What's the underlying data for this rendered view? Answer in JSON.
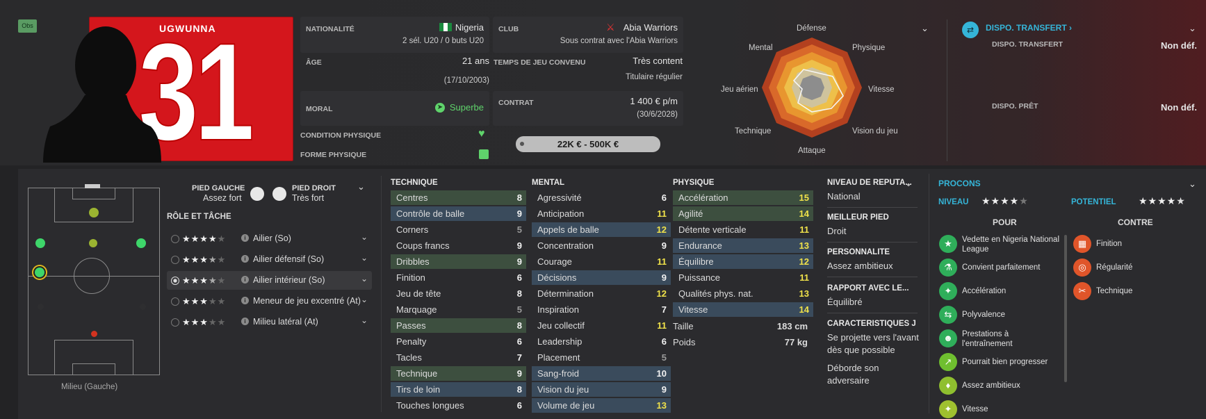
{
  "badge": "Obs",
  "player": {
    "name": "UGWUNNA",
    "number": "31"
  },
  "nationality": {
    "label": "NATIONALITÉ",
    "country": "Nigeria",
    "caps": "2 sél. U20 / 0 buts U20"
  },
  "club": {
    "label": "CLUB",
    "name": "Abia Warriors",
    "contract_note": "Sous contrat avec l'Abia Warriors"
  },
  "age": {
    "label": "ÂGE",
    "value": "21 ans",
    "dob": "(17/10/2003)"
  },
  "playing_time": {
    "label": "TEMPS DE JEU CONVENU",
    "satisfaction": "Très content",
    "status": "Titulaire régulier"
  },
  "morale": {
    "label": "MORAL",
    "value": "Superbe"
  },
  "contract": {
    "label": "CONTRAT",
    "wage": "1 400 € p/m",
    "expiry": "(30/6/2028)"
  },
  "condition": {
    "label": "CONDITION PHYSIQUE"
  },
  "form": {
    "label": "FORME PHYSIQUE"
  },
  "value_range": "22K € - 500K €",
  "radar": {
    "labels": [
      "Défense",
      "Physique",
      "Vitesse",
      "Vision du jeu",
      "Attaque",
      "Technique",
      "Jeu aérien",
      "Mental"
    ]
  },
  "transfer": {
    "header": "DISPO. TRANSFERT",
    "transfer_label": "DISPO. TRANSFERT",
    "transfer_value": "Non déf.",
    "loan_label": "DISPO. PRÊT",
    "loan_value": "Non déf."
  },
  "feet": {
    "left_label": "PIED GAUCHE",
    "left_value": "Assez fort",
    "right_label": "PIED DROIT",
    "right_value": "Très fort"
  },
  "roles_title": "RÔLE ET TÂCHE",
  "roles": [
    {
      "name": "Ailier (So)",
      "stars": 4
    },
    {
      "name": "Ailier défensif (So)",
      "stars": 3.5
    },
    {
      "name": "Ailier intérieur (So)",
      "stars": 3.5
    },
    {
      "name": "Meneur de jeu excentré (At)",
      "stars": 3
    },
    {
      "name": "Milieu latéral (At)",
      "stars": 3
    }
  ],
  "position_label": "Milieu (Gauche)",
  "technique": {
    "title": "TECHNIQUE",
    "attrs": [
      {
        "n": "Centres",
        "v": "8"
      },
      {
        "n": "Contrôle de balle",
        "v": "9"
      },
      {
        "n": "Corners",
        "v": "5"
      },
      {
        "n": "Coups francs",
        "v": "9"
      },
      {
        "n": "Dribbles",
        "v": "9"
      },
      {
        "n": "Finition",
        "v": "6"
      },
      {
        "n": "Jeu de tête",
        "v": "8"
      },
      {
        "n": "Marquage",
        "v": "5"
      },
      {
        "n": "Passes",
        "v": "8"
      },
      {
        "n": "Penalty",
        "v": "6"
      },
      {
        "n": "Tacles",
        "v": "7"
      },
      {
        "n": "Technique",
        "v": "9"
      },
      {
        "n": "Tirs de loin",
        "v": "8"
      },
      {
        "n": "Touches longues",
        "v": "6"
      }
    ]
  },
  "mental": {
    "title": "MENTAL",
    "attrs": [
      {
        "n": "Agressivité",
        "v": "6"
      },
      {
        "n": "Anticipation",
        "v": "11"
      },
      {
        "n": "Appels de balle",
        "v": "12"
      },
      {
        "n": "Concentration",
        "v": "9"
      },
      {
        "n": "Courage",
        "v": "11"
      },
      {
        "n": "Décisions",
        "v": "9"
      },
      {
        "n": "Détermination",
        "v": "12"
      },
      {
        "n": "Inspiration",
        "v": "7"
      },
      {
        "n": "Jeu collectif",
        "v": "11"
      },
      {
        "n": "Leadership",
        "v": "6"
      },
      {
        "n": "Placement",
        "v": "5"
      },
      {
        "n": "Sang-froid",
        "v": "10"
      },
      {
        "n": "Vision du jeu",
        "v": "9"
      },
      {
        "n": "Volume de jeu",
        "v": "13"
      }
    ]
  },
  "physique": {
    "title": "PHYSIQUE",
    "attrs": [
      {
        "n": "Accélération",
        "v": "15"
      },
      {
        "n": "Agilité",
        "v": "14"
      },
      {
        "n": "Détente verticale",
        "v": "11"
      },
      {
        "n": "Endurance",
        "v": "13"
      },
      {
        "n": "Équilibre",
        "v": "12"
      },
      {
        "n": "Puissance",
        "v": "11"
      },
      {
        "n": "Qualités phys. nat.",
        "v": "13"
      },
      {
        "n": "Vitesse",
        "v": "14"
      }
    ],
    "height_label": "Taille",
    "height": "183 cm",
    "weight_label": "Poids",
    "weight": "77 kg"
  },
  "info": {
    "rep_label": "NIVEAU DE RÉPUTA...",
    "rep_value": "National",
    "foot_label": "MEILLEUR PIED",
    "foot_value": "Droit",
    "pers_label": "PERSONNALITÉ",
    "pers_value": "Assez ambitieux",
    "media_label": "RAPPORT AVEC LE...",
    "media_value": "Équilibré",
    "traits_label": "CARACTÉRISTIQUES J",
    "trait1": "Se projette vers l'avant dès que possible",
    "trait2": "Déborde son adversaire"
  },
  "procons": {
    "title": "PROCONS",
    "level_label": "NIVEAU",
    "level_stars": 4,
    "potential_label": "POTENTIEL",
    "potential_stars": 4.5,
    "pros_title": "POUR",
    "cons_title": "CONTRE",
    "pros": [
      "Vedette en Nigeria National League",
      "Convient parfaitement",
      "Accélération",
      "Polyvalence",
      "Prestations à l'entraînement",
      "Pourrait bien progresser",
      "Assez ambitieux",
      "Vitesse"
    ],
    "cons": [
      "Finition",
      "Régularité",
      "Technique"
    ]
  },
  "colors": {
    "accent": "#35b5d8",
    "green": "#5fd36b",
    "yellow": "#f0e24a",
    "key_attr": "#3d4f3f",
    "key_attr_blue": "#3a4b5c"
  }
}
